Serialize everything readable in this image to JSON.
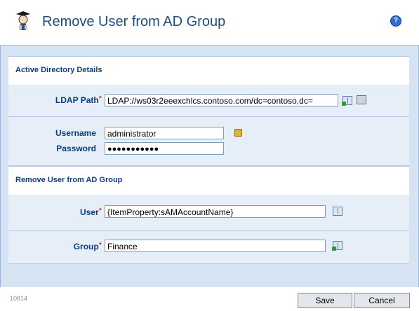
{
  "header": {
    "title": "Remove User from AD Group",
    "help_glyph": "?"
  },
  "sections": {
    "ad_details": {
      "heading": "Active Directory Details"
    },
    "remove_user": {
      "heading": "Remove User from AD Group"
    }
  },
  "fields": {
    "ldap_path": {
      "label": "LDAP Path",
      "required_mark": "*",
      "value": "LDAP://ws03r2eeexchlcs.contoso.com/dc=contoso,dc="
    },
    "username": {
      "label": "Username",
      "value": "administrator"
    },
    "password": {
      "label": "Password",
      "value": "●●●●●●●●●●●"
    },
    "user": {
      "label": "User",
      "required_mark": "*",
      "value": "{ItemProperty:sAMAccountName}"
    },
    "group": {
      "label": "Group",
      "required_mark": "*",
      "value": "Finance"
    }
  },
  "footer": {
    "code": "10814",
    "save_label": "Save",
    "cancel_label": "Cancel"
  },
  "icons": {
    "logo": "workflow-logo-icon",
    "help": "help-icon",
    "ldap_browse": "address-book-add-icon",
    "ldap_servers": "servers-icon",
    "lock": "lock-icon",
    "user_browse": "address-book-icon",
    "group_browse": "address-book-add-icon"
  },
  "colors": {
    "title": "#1f4e79",
    "label": "#0b3d7d",
    "required": "#c00000",
    "panel": "#d6e3f3",
    "row": "#e6eef8"
  }
}
